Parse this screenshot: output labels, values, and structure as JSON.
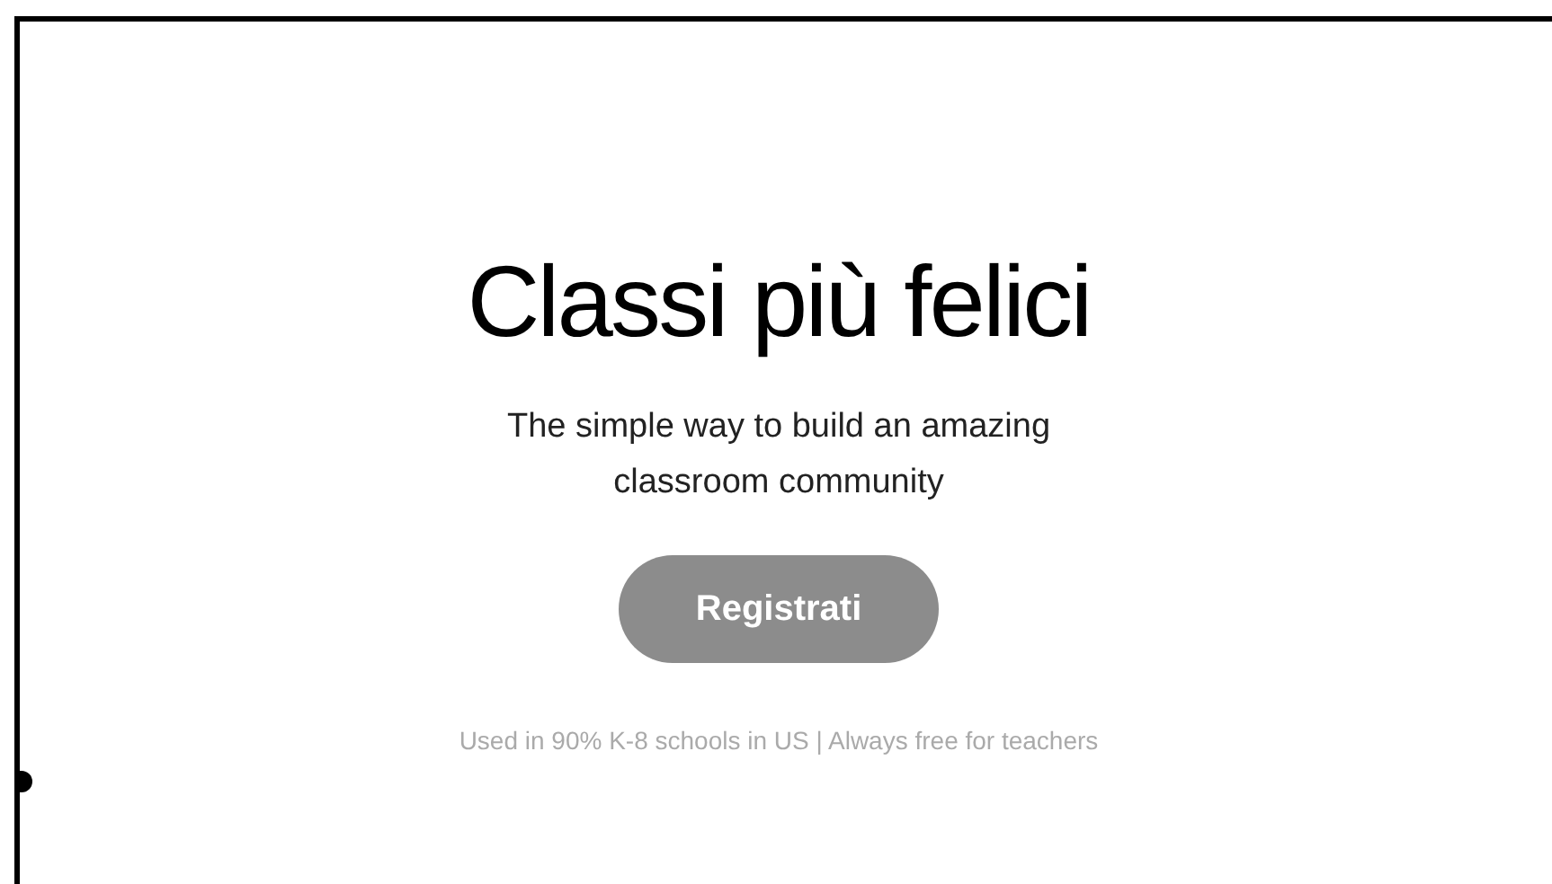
{
  "hero": {
    "title": "Classi più felici",
    "subtitle": "The simple way to build an amazing classroom community",
    "button": "Registrati",
    "footnote": "Used in 90% K-8 schools in US | Always free for teachers"
  }
}
